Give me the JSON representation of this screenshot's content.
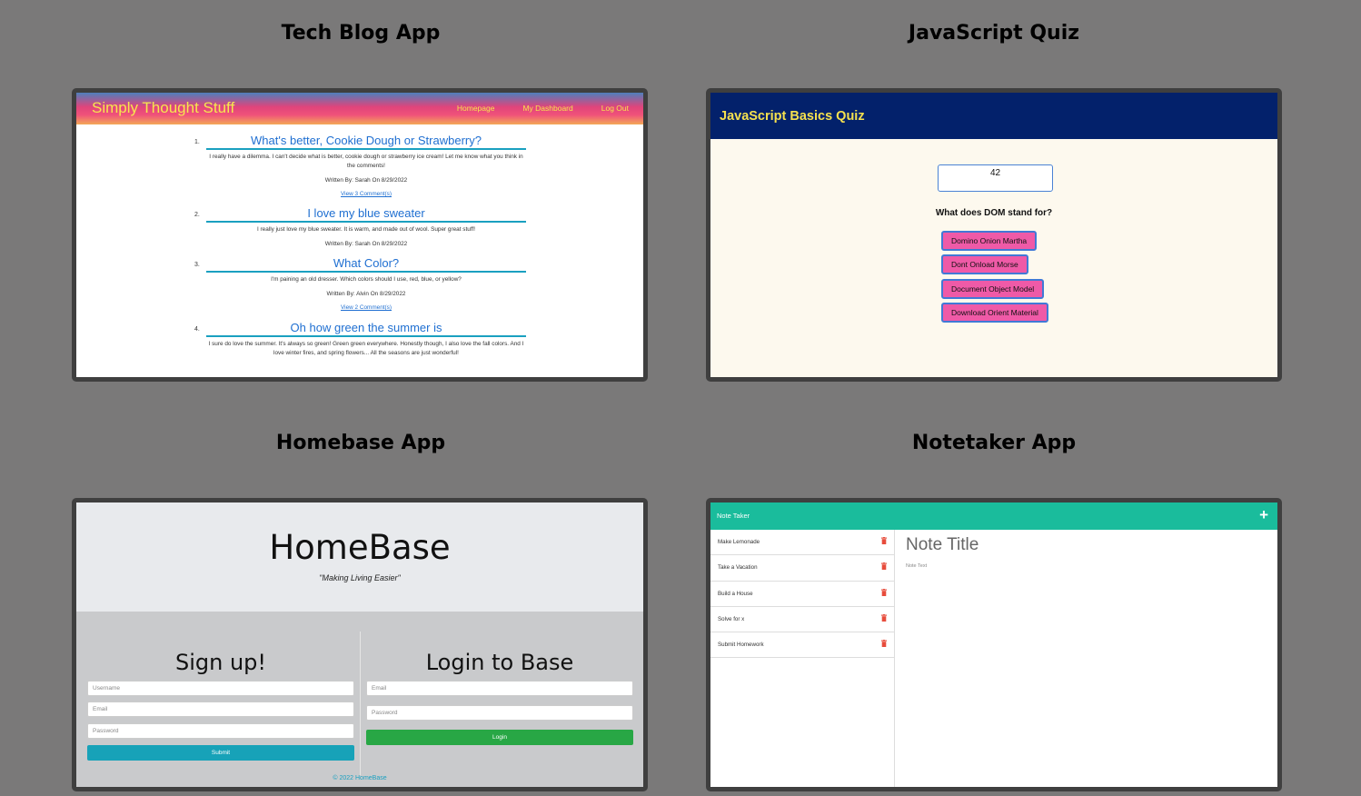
{
  "projects": [
    {
      "title": "Tech Blog App"
    },
    {
      "title": "JavaScript Quiz"
    },
    {
      "title": "Homebase App"
    },
    {
      "title": "Notetaker App"
    }
  ],
  "techblog": {
    "brand": "Simply Thought Stuff",
    "nav": [
      "Homepage",
      "My Dashboard",
      "Log Out"
    ],
    "posts": [
      {
        "num": "1.",
        "title": "What's better, Cookie Dough or Strawberry?",
        "body": "I really have a dilemma. I can't decide what is better, cookie dough or strawberry ice cream! Let me know what you think in the comments!",
        "meta": "Written By: Sarah On 8/29/2022",
        "link": "View 3 Comment(s)"
      },
      {
        "num": "2.",
        "title": "I love my blue sweater",
        "body": "I really just love my blue sweater. It is warm, and made out of wool. Super great stuff!",
        "meta": "Written By: Sarah On 8/29/2022",
        "link": ""
      },
      {
        "num": "3.",
        "title": "What Color?",
        "body": "I'm paining an old dresser. Which colors should I use, red, blue, or yellow?",
        "meta": "Written By: Alvin On 8/29/2022",
        "link": "View 2 Comment(s)"
      },
      {
        "num": "4.",
        "title": "Oh how green the summer is",
        "body": "I sure do love the summer. It's always so green! Green green everywhere. Honestly though, I also love the fall colors. And I love winter fires, and spring flowers... All the seasons are just wonderful!",
        "meta": "",
        "link": ""
      }
    ]
  },
  "quiz": {
    "title": "JavaScript Basics Quiz",
    "timer": "42",
    "question": "What does DOM stand for?",
    "answers": [
      "Domino Onion Martha",
      "Dont Onload Morse",
      "Document Object Model",
      "Download Orient Material"
    ]
  },
  "homebase": {
    "logo": "HomeBase",
    "tagline": "\"Making Living Easier\"",
    "signup": {
      "heading": "Sign up!",
      "username": "Username",
      "email": "Email",
      "password": "Password",
      "submit": "Submit"
    },
    "login": {
      "heading": "Login to Base",
      "email": "Email",
      "password": "Password",
      "submit": "Login"
    },
    "footer": "© 2022 HomeBase"
  },
  "notetaker": {
    "brand": "Note Taker",
    "plus": "+",
    "notes": [
      "Make Lemonade",
      "Take a Vacation",
      "Build a House",
      "Solve for x",
      "Submit Homework"
    ],
    "title_placeholder": "Note Title",
    "text_placeholder": "Note Text"
  }
}
